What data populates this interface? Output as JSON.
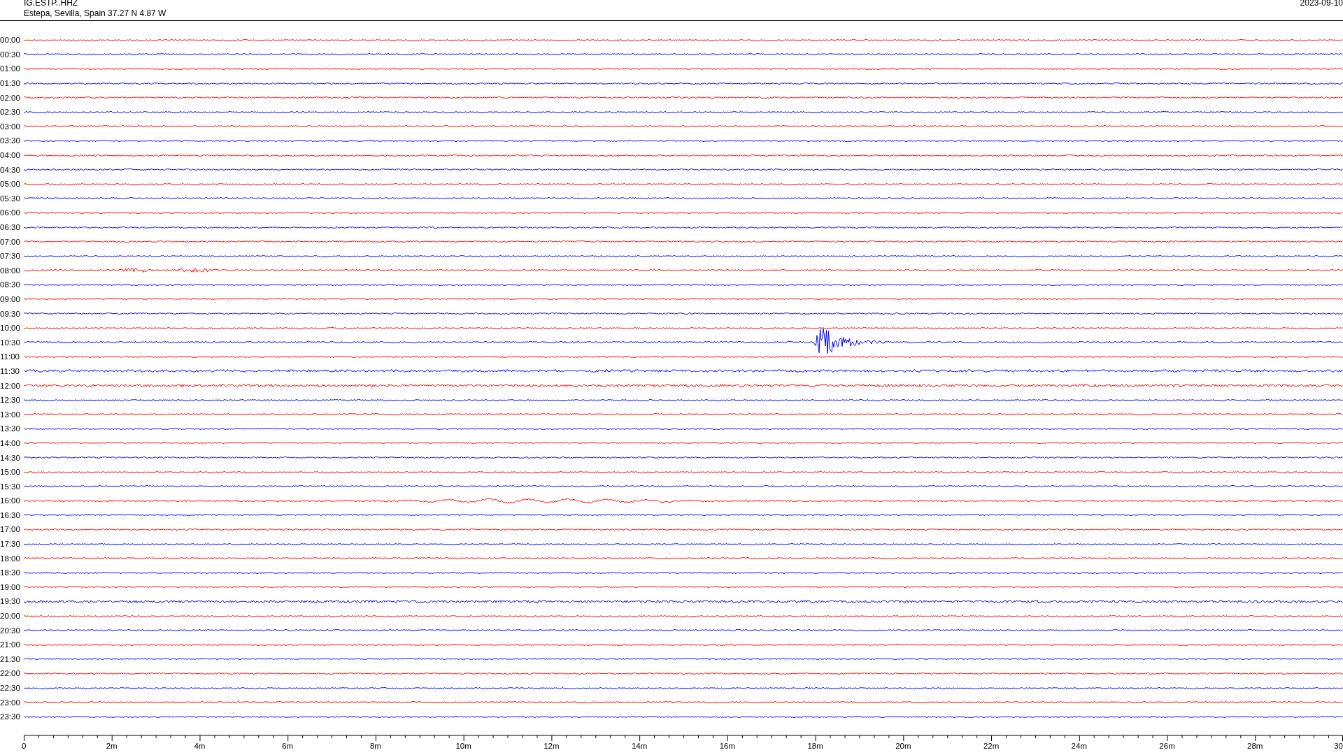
{
  "header": {
    "station": "IG.ESTP..HHZ",
    "location": "Estepa, Sevilla, Spain  37.27 N 4.87 W",
    "date": "2023-09-10"
  },
  "rows": [
    {
      "time": "00:00",
      "color": "#ff0000",
      "kind": "quiet"
    },
    {
      "time": "00:30",
      "color": "#0000ff",
      "kind": "quiet"
    },
    {
      "time": "01:00",
      "color": "#ff0000",
      "kind": "quiet"
    },
    {
      "time": "01:30",
      "color": "#0000ff",
      "kind": "quiet"
    },
    {
      "time": "02:00",
      "color": "#ff0000",
      "kind": "quiet"
    },
    {
      "time": "02:30",
      "color": "#0000ff",
      "kind": "quiet"
    },
    {
      "time": "03:00",
      "color": "#ff0000",
      "kind": "quiet"
    },
    {
      "time": "03:30",
      "color": "#0000ff",
      "kind": "quiet"
    },
    {
      "time": "04:00",
      "color": "#ff0000",
      "kind": "quiet"
    },
    {
      "time": "04:30",
      "color": "#0000ff",
      "kind": "quiet"
    },
    {
      "time": "05:00",
      "color": "#ff0000",
      "kind": "quiet"
    },
    {
      "time": "05:30",
      "color": "#0000ff",
      "kind": "quiet"
    },
    {
      "time": "06:00",
      "color": "#ff0000",
      "kind": "quiet"
    },
    {
      "time": "06:30",
      "color": "#0000ff",
      "kind": "quiet"
    },
    {
      "time": "07:00",
      "color": "#ff0000",
      "kind": "quiet"
    },
    {
      "time": "07:30",
      "color": "#0000ff",
      "kind": "quiet"
    },
    {
      "time": "08:00",
      "color": "#ff0000",
      "kind": "burst"
    },
    {
      "time": "08:30",
      "color": "#0000ff",
      "kind": "quiet"
    },
    {
      "time": "09:00",
      "color": "#ff0000",
      "kind": "quiet"
    },
    {
      "time": "09:30",
      "color": "#0000ff",
      "kind": "quiet"
    },
    {
      "time": "10:00",
      "color": "#ff0000",
      "kind": "quiet"
    },
    {
      "time": "10:30",
      "color": "#0000ff",
      "kind": "event"
    },
    {
      "time": "11:00",
      "color": "#ff0000",
      "kind": "quiet"
    },
    {
      "time": "11:30",
      "color": "#0000ff",
      "kind": "noisy"
    },
    {
      "time": "12:00",
      "color": "#ff0000",
      "kind": "noisy"
    },
    {
      "time": "12:30",
      "color": "#0000ff",
      "kind": "quiet"
    },
    {
      "time": "13:00",
      "color": "#ff0000",
      "kind": "quiet"
    },
    {
      "time": "13:30",
      "color": "#0000ff",
      "kind": "quiet"
    },
    {
      "time": "14:00",
      "color": "#ff0000",
      "kind": "quiet"
    },
    {
      "time": "14:30",
      "color": "#0000ff",
      "kind": "quiet"
    },
    {
      "time": "15:00",
      "color": "#ff0000",
      "kind": "quiet"
    },
    {
      "time": "15:30",
      "color": "#0000ff",
      "kind": "quiet"
    },
    {
      "time": "16:00",
      "color": "#ff0000",
      "kind": "swell"
    },
    {
      "time": "16:30",
      "color": "#0000ff",
      "kind": "quiet"
    },
    {
      "time": "17:00",
      "color": "#ff0000",
      "kind": "quiet"
    },
    {
      "time": "17:30",
      "color": "#0000ff",
      "kind": "quiet"
    },
    {
      "time": "18:00",
      "color": "#ff0000",
      "kind": "quiet"
    },
    {
      "time": "18:30",
      "color": "#0000ff",
      "kind": "quiet"
    },
    {
      "time": "19:00",
      "color": "#ff0000",
      "kind": "quiet"
    },
    {
      "time": "19:30",
      "color": "#0000ff",
      "kind": "noisy"
    },
    {
      "time": "20:00",
      "color": "#ff0000",
      "kind": "quiet"
    },
    {
      "time": "20:30",
      "color": "#0000ff",
      "kind": "quiet"
    },
    {
      "time": "21:00",
      "color": "#ff0000",
      "kind": "quiet"
    },
    {
      "time": "21:30",
      "color": "#0000ff",
      "kind": "quiet"
    },
    {
      "time": "22:00",
      "color": "#ff0000",
      "kind": "quiet"
    },
    {
      "time": "22:30",
      "color": "#0000ff",
      "kind": "quiet"
    },
    {
      "time": "23:00",
      "color": "#ff0000",
      "kind": "quiet"
    },
    {
      "time": "23:30",
      "color": "#0000ff",
      "kind": "quiet"
    }
  ],
  "axis": {
    "labels": [
      "0",
      "2m",
      "4m",
      "6m",
      "8m",
      "10m",
      "12m",
      "14m",
      "16m",
      "18m",
      "20m",
      "22m",
      "24m",
      "26m",
      "28m",
      "30"
    ]
  }
}
